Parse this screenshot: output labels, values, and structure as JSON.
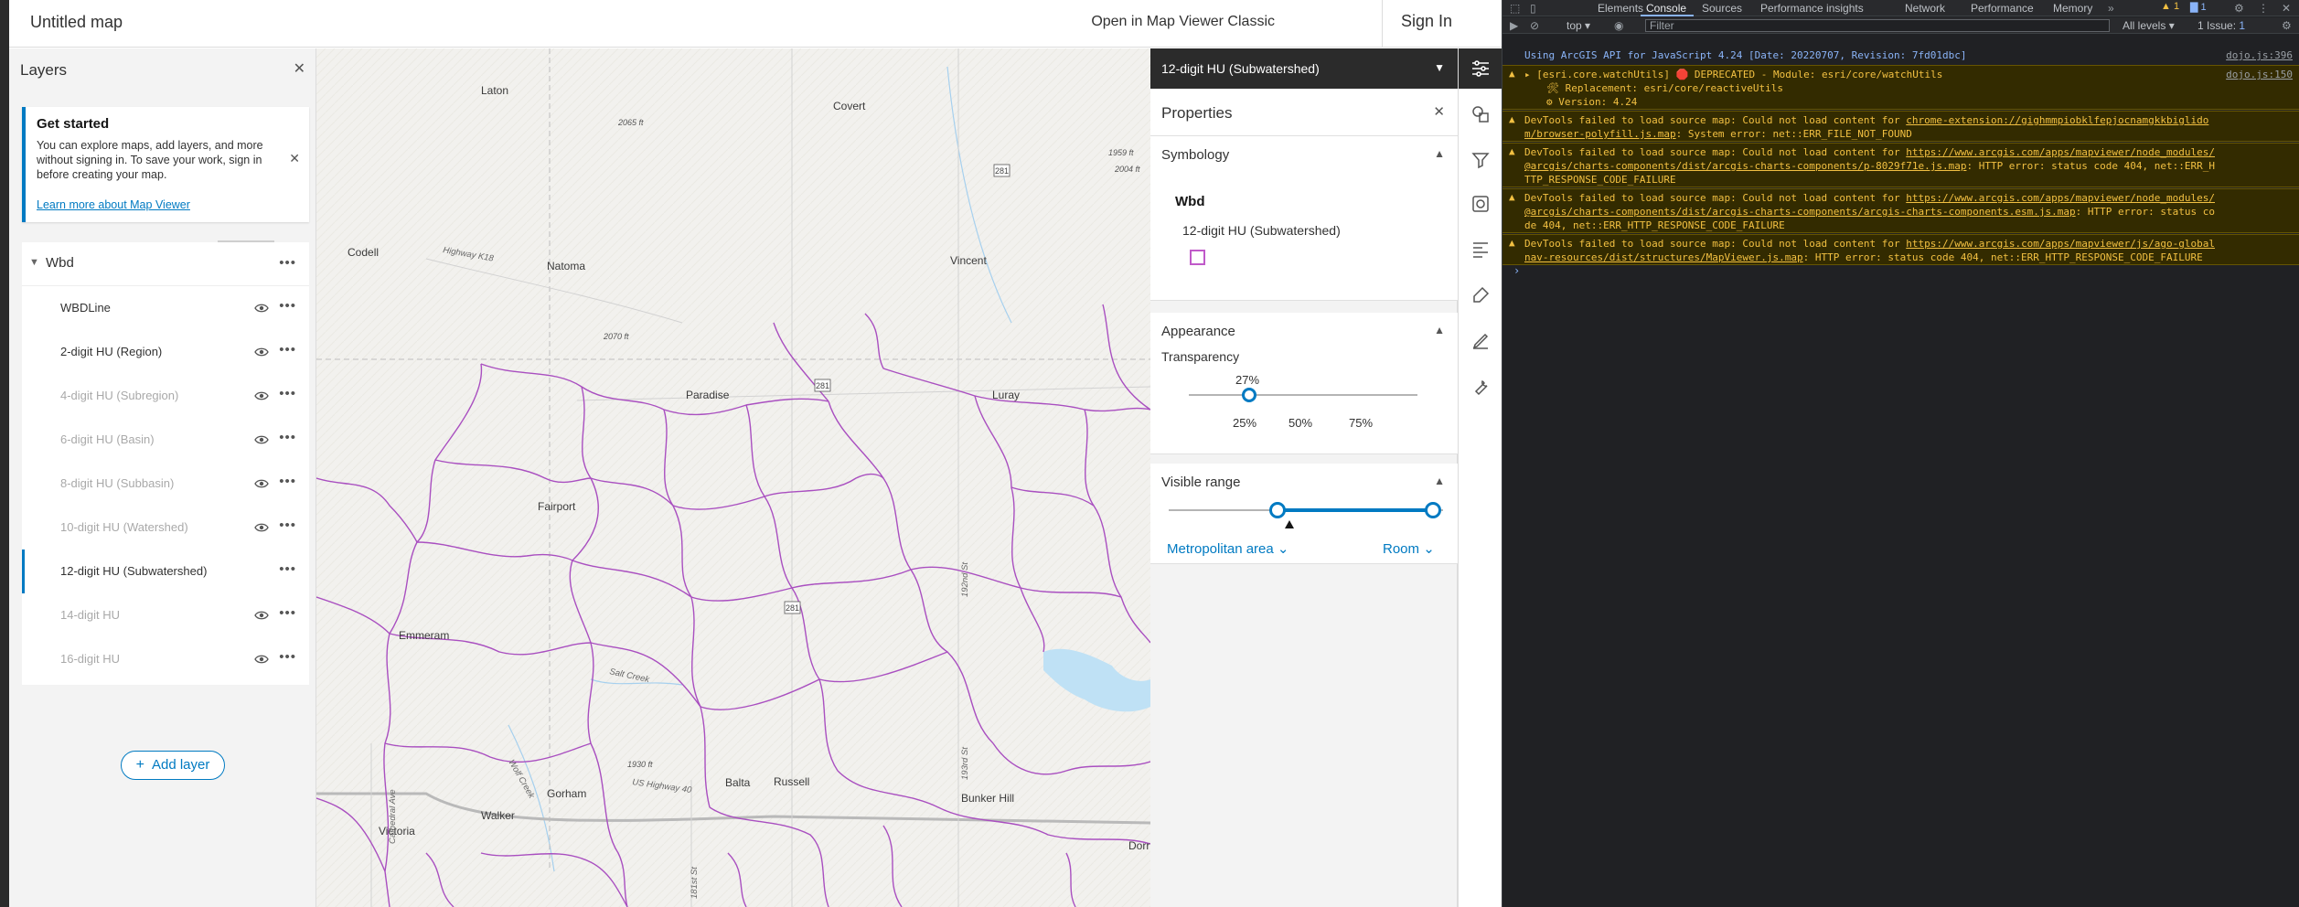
{
  "app": {
    "title": "Untitled map",
    "classic_link": "Open in Map Viewer Classic",
    "sign_in": "Sign In"
  },
  "layers_panel": {
    "title": "Layers",
    "get_started": {
      "title": "Get started",
      "body": "You can explore maps, add layers, and more without signing in. To save your work, sign in before creating your map.",
      "link": "Learn more about Map Viewer"
    },
    "group": {
      "label": "Wbd"
    },
    "layers": [
      {
        "label": "WBDLine",
        "visible": true
      },
      {
        "label": "2-digit HU (Region)",
        "visible": true
      },
      {
        "label": "4-digit HU (Subregion)",
        "visible": false
      },
      {
        "label": "6-digit HU (Basin)",
        "visible": false
      },
      {
        "label": "8-digit HU (Subbasin)",
        "visible": false
      },
      {
        "label": "10-digit HU (Watershed)",
        "visible": false
      },
      {
        "label": "12-digit HU (Subwatershed)",
        "visible": true,
        "selected": true
      },
      {
        "label": "14-digit HU",
        "visible": false
      },
      {
        "label": "16-digit HU",
        "visible": false
      }
    ],
    "add_layer": "Add layer"
  },
  "map": {
    "places": [
      "Laton",
      "Covert",
      "Codell",
      "Natoma",
      "Vincent",
      "Paradise",
      "Luray",
      "Fairport",
      "Emmeram",
      "Gorham",
      "Balta",
      "Russell",
      "Bunker Hill",
      "Walker",
      "Victoria",
      "Dorr"
    ],
    "roads": [
      "Highway K18",
      "US Highway 40",
      "Wolf Creek",
      "Salt Creek",
      "Cathedral Ave",
      "181st St",
      "192nd St",
      "193rd St"
    ],
    "elevations": [
      "2065 ft",
      "2070 ft",
      "1959 ft",
      "2004 ft",
      "1930 ft"
    ],
    "route_shields": [
      "281",
      "281",
      "281"
    ],
    "boundary_color": "#a94fc0",
    "water_color": "#bfe1f5"
  },
  "properties": {
    "layer_name": "12-digit HU (Subwatershed)",
    "title": "Properties",
    "symbology": {
      "title": "Symbology",
      "group": "Wbd",
      "item": "12-digit HU (Subwatershed)",
      "swatch_color": "#c05ac9"
    },
    "appearance": {
      "title": "Appearance",
      "transparency_label": "Transparency",
      "transparency_value": "27%",
      "transparency_fraction": 0.27,
      "ticks": [
        "25%",
        "50%",
        "75%"
      ]
    },
    "visible_range": {
      "title": "Visible range",
      "min_label": "Metropolitan area",
      "max_label": "Room"
    }
  },
  "toolstrip": {
    "tools": [
      "properties-icon",
      "styles-icon",
      "filter-icon",
      "effects-icon",
      "labels-icon",
      "popups-icon",
      "edit-icon",
      "configure-icon"
    ]
  },
  "devtools": {
    "tabs": [
      "Elements",
      "Console",
      "Sources",
      "Performance insights",
      "Network",
      "Performance",
      "Memory"
    ],
    "active_tab": "Console",
    "warnings_count": "1",
    "messages_count": "1",
    "context": "top",
    "filter_placeholder": "Filter",
    "levels": "All levels",
    "issues": "1 Issue:",
    "issues_count": "1",
    "messages": [
      {
        "level": "info",
        "text": "Using ArcGIS API for JavaScript 4.24 [Date: 20220707, Revision: 7fd01dbc]",
        "source": "dojo.js:396"
      },
      {
        "level": "warn",
        "text": "▸ [esri.core.watchUtils] 🛑 DEPRECATED - Module: esri/core/watchUtils",
        "line2": "🛠 Replacement: esri/core/reactiveUtils",
        "line3": "⚙ Version: 4.24",
        "source": "dojo.js:150"
      },
      {
        "level": "warn",
        "prefix": "DevTools failed to load source map: Could not load content for ",
        "url": "chrome-extension://gighmmpiobklfepjocnamgkkbiglidom/browser-polyfill.js.map",
        "suffix": ": System error: net::ERR_FILE_NOT_FOUND"
      },
      {
        "level": "warn",
        "prefix": "DevTools failed to load source map: Could not load content for ",
        "url": "https://www.arcgis.com/apps/mapviewer/node_modules/@arcgis/charts-components/dist/arcgis-charts-components/p-8029f71e.js.map",
        "suffix": ": HTTP error: status code 404, net::ERR_HTTP_RESPONSE_CODE_FAILURE"
      },
      {
        "level": "warn",
        "prefix": "DevTools failed to load source map: Could not load content for ",
        "url": "https://www.arcgis.com/apps/mapviewer/node_modules/@arcgis/charts-components/dist/arcgis-charts-components/arcgis-charts-components.esm.js.map",
        "suffix": ": HTTP error: status code 404, net::ERR_HTTP_RESPONSE_CODE_FAILURE"
      },
      {
        "level": "warn",
        "prefix": "DevTools failed to load source map: Could not load content for ",
        "url": "https://www.arcgis.com/apps/mapviewer/js/ago-globalnav-resources/dist/structures/MapViewer.js.map",
        "suffix": ": HTTP error: status code 404, net::ERR_HTTP_RESPONSE_CODE_FAILURE"
      }
    ]
  }
}
